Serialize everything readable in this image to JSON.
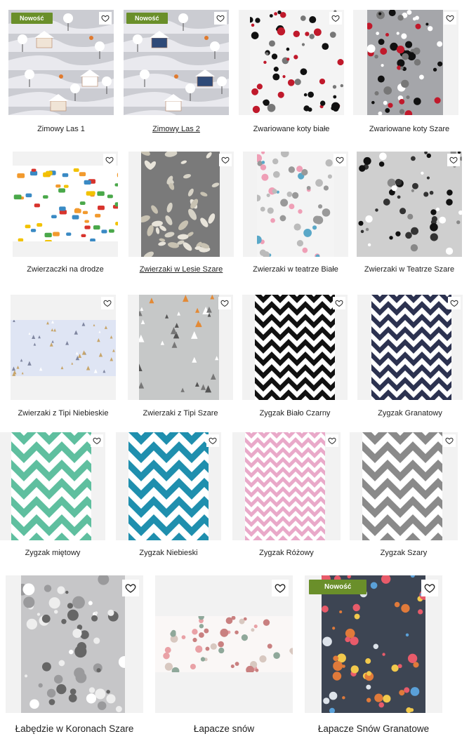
{
  "products": [
    {
      "name": "Zimowy Las 1",
      "badge": "Nowość",
      "pattern": "winter"
    },
    {
      "name": "Zimowy Las 2",
      "badge": "Nowość",
      "pattern": "winter2"
    },
    {
      "name": "Zwariowane koty białe",
      "badge": "",
      "pattern": "cats"
    },
    {
      "name": "Zwariowane koty Szare",
      "badge": "",
      "pattern": "cats-grey"
    },
    {
      "name": "Zwierzaczki na drodze",
      "badge": "",
      "pattern": "cars"
    },
    {
      "name": "Zwierzaki w Lesie Szare",
      "badge": "",
      "pattern": "forest-grey"
    },
    {
      "name": "Zwierzaki w teatrze Białe",
      "badge": "",
      "pattern": "theatre"
    },
    {
      "name": "Zwierzaki w Teatrze Szare",
      "badge": "",
      "pattern": "theatre-grey"
    },
    {
      "name": "Zwierzaki z Tipi Niebieskie",
      "badge": "",
      "pattern": "tipi-blue"
    },
    {
      "name": "Zwierzaki z Tipi Szare",
      "badge": "",
      "pattern": "tipi-grey"
    },
    {
      "name": "Zygzak Biało Czarny",
      "badge": "",
      "pattern": "zig-black"
    },
    {
      "name": "Zygzak Granatowy",
      "badge": "",
      "pattern": "zig-navy"
    },
    {
      "name": "Zygzak miętowy",
      "badge": "",
      "pattern": "zig-mint"
    },
    {
      "name": "Zygzak Niebieski",
      "badge": "",
      "pattern": "zig-blue"
    },
    {
      "name": "Zygzak Różowy",
      "badge": "",
      "pattern": "zig-pink"
    },
    {
      "name": "Zygzak Szary",
      "badge": "",
      "pattern": "zig-grey"
    },
    {
      "name": "Łabędzie w Koronach Szare",
      "badge": "",
      "pattern": "swans"
    },
    {
      "name": "Łapacze snów",
      "badge": "",
      "pattern": "dream-white"
    },
    {
      "name": "Łapacze Snów Granatowe",
      "badge": "Nowość",
      "pattern": "dream-navy"
    }
  ],
  "colors": {
    "badge": "#6a8f2a",
    "mint": "#5fbf9f",
    "teal": "#1f8fae",
    "pink": "#e9a9c9",
    "grey": "#8a8a8a",
    "navy": "#2c3250",
    "black": "#111111"
  },
  "icons": {
    "wishlist": "heart-outline-icon"
  }
}
